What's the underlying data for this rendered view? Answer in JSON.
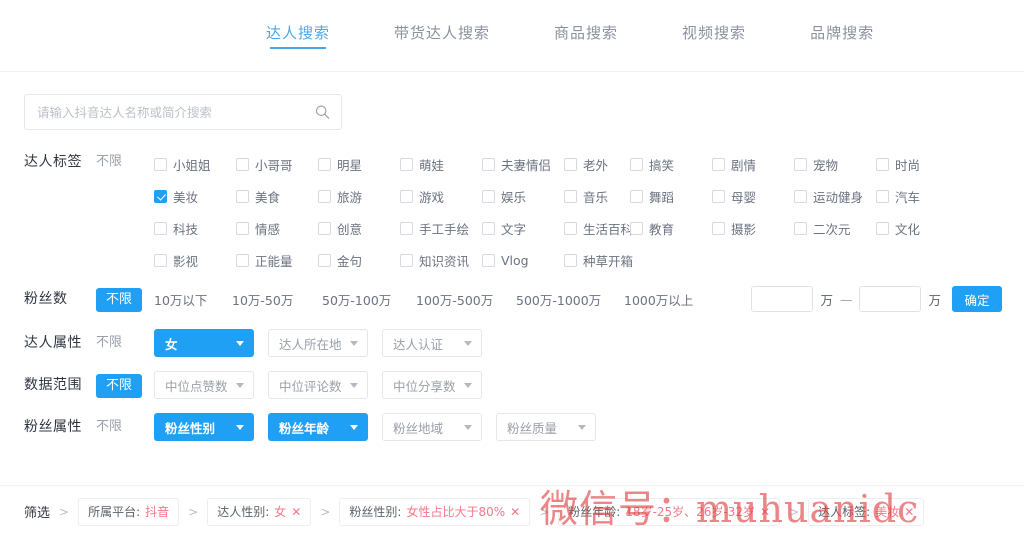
{
  "tabs": [
    {
      "label": "达人搜索",
      "active": true
    },
    {
      "label": "带货达人搜索",
      "active": false
    },
    {
      "label": "商品搜索",
      "active": false
    },
    {
      "label": "视频搜索",
      "active": false
    },
    {
      "label": "品牌搜索",
      "active": false
    }
  ],
  "search": {
    "placeholder": "请输入抖音达人名称或简介搜索",
    "value": "",
    "icon": "search-icon"
  },
  "tag_filter": {
    "label": "达人标签",
    "unlimited": "不限",
    "unlimited_active": false,
    "rows": [
      [
        {
          "label": "小姐姐",
          "checked": false
        },
        {
          "label": "小哥哥",
          "checked": false
        },
        {
          "label": "明星",
          "checked": false
        },
        {
          "label": "萌娃",
          "checked": false
        },
        {
          "label": "夫妻情侣",
          "checked": false
        },
        {
          "label": "老外",
          "checked": false
        },
        {
          "label": "搞笑",
          "checked": false
        },
        {
          "label": "剧情",
          "checked": false
        },
        {
          "label": "宠物",
          "checked": false
        },
        {
          "label": "时尚",
          "checked": false
        }
      ],
      [
        {
          "label": "美妆",
          "checked": true
        },
        {
          "label": "美食",
          "checked": false
        },
        {
          "label": "旅游",
          "checked": false
        },
        {
          "label": "游戏",
          "checked": false
        },
        {
          "label": "娱乐",
          "checked": false
        },
        {
          "label": "音乐",
          "checked": false
        },
        {
          "label": "舞蹈",
          "checked": false
        },
        {
          "label": "母婴",
          "checked": false
        },
        {
          "label": "运动健身",
          "checked": false
        },
        {
          "label": "汽车",
          "checked": false
        }
      ],
      [
        {
          "label": "科技",
          "checked": false
        },
        {
          "label": "情感",
          "checked": false
        },
        {
          "label": "创意",
          "checked": false
        },
        {
          "label": "手工手绘",
          "checked": false
        },
        {
          "label": "文字",
          "checked": false
        },
        {
          "label": "生活百科",
          "checked": false
        },
        {
          "label": "教育",
          "checked": false
        },
        {
          "label": "摄影",
          "checked": false
        },
        {
          "label": "二次元",
          "checked": false
        },
        {
          "label": "文化",
          "checked": false
        }
      ],
      [
        {
          "label": "影视",
          "checked": false
        },
        {
          "label": "正能量",
          "checked": false
        },
        {
          "label": "金句",
          "checked": false
        },
        {
          "label": "知识资讯",
          "checked": false
        },
        {
          "label": "Vlog",
          "checked": false
        },
        {
          "label": "种草开箱",
          "checked": false
        }
      ]
    ]
  },
  "fans_count": {
    "label": "粉丝数",
    "unlimited": "不限",
    "unlimited_active": true,
    "options": [
      "10万以下",
      "10万-50万",
      "50万-100万",
      "100万-500万",
      "500万-1000万",
      "1000万以上"
    ],
    "min_value": "",
    "max_value": "",
    "unit": "万",
    "dash": "—",
    "confirm_label": "确定"
  },
  "influencer_attr": {
    "label": "达人属性",
    "unlimited": "不限",
    "unlimited_active": false,
    "dropdowns": [
      {
        "label": "女",
        "active": true
      },
      {
        "label": "达人所在地",
        "active": false
      },
      {
        "label": "达人认证",
        "active": false
      }
    ]
  },
  "data_range": {
    "label": "数据范围",
    "unlimited": "不限",
    "unlimited_active": true,
    "dropdowns": [
      {
        "label": "中位点赞数",
        "active": false
      },
      {
        "label": "中位评论数",
        "active": false
      },
      {
        "label": "中位分享数",
        "active": false
      }
    ]
  },
  "fans_attr": {
    "label": "粉丝属性",
    "unlimited": "不限",
    "unlimited_active": false,
    "dropdowns": [
      {
        "label": "粉丝性别",
        "active": true
      },
      {
        "label": "粉丝年龄",
        "active": true
      },
      {
        "label": "粉丝地域",
        "active": false
      },
      {
        "label": "粉丝质量",
        "active": false
      }
    ]
  },
  "breadcrumb": {
    "title": "筛选",
    "separator": ">",
    "chips": [
      {
        "key": "所属平台:",
        "value": "抖音",
        "removable": false
      },
      {
        "key": "达人性别:",
        "value": "女",
        "removable": true
      },
      {
        "key": "粉丝性别:",
        "value": "女性占比大于80%",
        "removable": true
      },
      {
        "key": "粉丝年龄:",
        "value": "18岁-25岁、26岁-32岁",
        "removable": true
      },
      {
        "key": "达人标签:",
        "value": "美妆",
        "removable": true
      }
    ],
    "remove_glyph": "✕"
  },
  "watermark": {
    "text": "微信号：muhuanidc"
  },
  "colors": {
    "accent": "#20a0f5",
    "tab_active": "#4aa8e8",
    "chip_value": "#f1798a",
    "watermark": "#e03c3c"
  }
}
